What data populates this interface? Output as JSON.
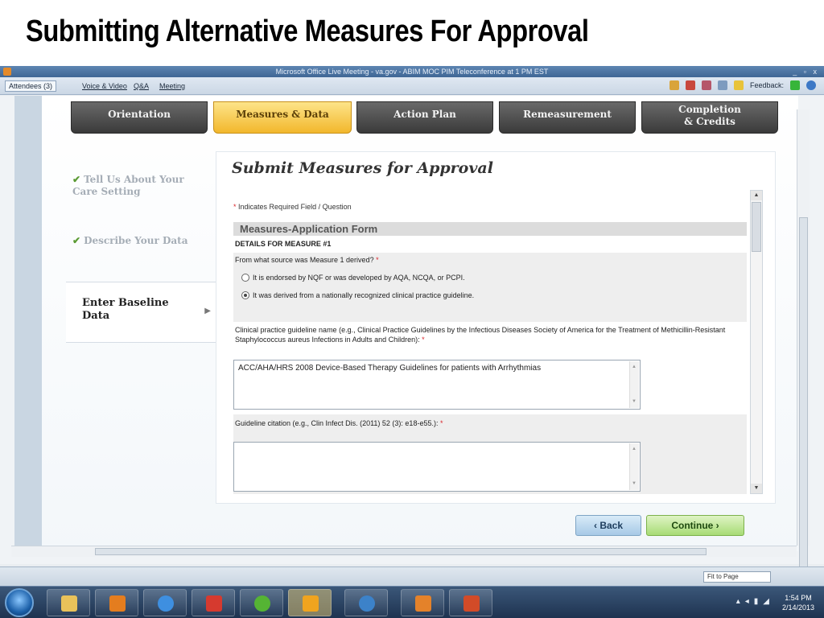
{
  "slide_title": "Submitting Alternative Measures For Approval",
  "window": {
    "title": "Microsoft Office Live Meeting - va.gov - ABIM MOC PIM Teleconference at 1 PM EST",
    "controls": "_ ▫ x"
  },
  "menu": {
    "attendees": "Attendees (3)",
    "voice_video": "Voice & Video",
    "qa": "Q&A",
    "meeting": "Meeting",
    "feedback": "Feedback:"
  },
  "tabs": [
    {
      "label": "Orientation",
      "active": false
    },
    {
      "label": "Measures & Data",
      "active": true
    },
    {
      "label": "Action Plan",
      "active": false
    },
    {
      "label": "Remeasurement",
      "active": false
    },
    {
      "label": "Completion & Credits",
      "active": false
    }
  ],
  "steps": {
    "step1": "Tell Us About Your Care Setting",
    "step2": "Describe Your Data",
    "step3": "Enter Baseline Data"
  },
  "form": {
    "title": "Submit Measures for Approval",
    "required_note": "Indicates Required Field / Question",
    "required_marker": "*",
    "section_header": "Measures-Application Form",
    "details_header": "DETAILS FOR MEASURE #1",
    "q_source": "From what source was Measure 1 derived?",
    "option1": "It is endorsed by NQF or was developed by AQA, NCQA, or PCPI.",
    "option2": "It was derived from a nationally recognized clinical practice guideline.",
    "selected_option": 2,
    "q_guideline_name": "Clinical practice guideline name (e.g., Clinical Practice Guidelines by the Infectious Diseases Society of America for the Treatment of Methicillin-Resistant Staphylococcus aureus Infections in Adults and Children):",
    "guideline_name_value": "ACC/AHA/HRS 2008 Device-Based Therapy Guidelines for patients with Arrhythmias",
    "q_citation": "Guideline citation (e.g., Clin Infect Dis. (2011) 52 (3): e18-e55.):",
    "citation_value": ""
  },
  "buttons": {
    "back": "‹ Back",
    "continue": "Continue ›"
  },
  "status_bar": {
    "fit_page": "Fit to Page"
  },
  "taskbar": {
    "time": "1:54 PM",
    "date": "2/14/2013"
  },
  "colors": {
    "active_tab": "#f2b72c",
    "inactive_tab": "#4a4a4a",
    "continue_button": "#a7db75",
    "back_button": "#a7c9e6",
    "required_star": "#d9262c"
  }
}
